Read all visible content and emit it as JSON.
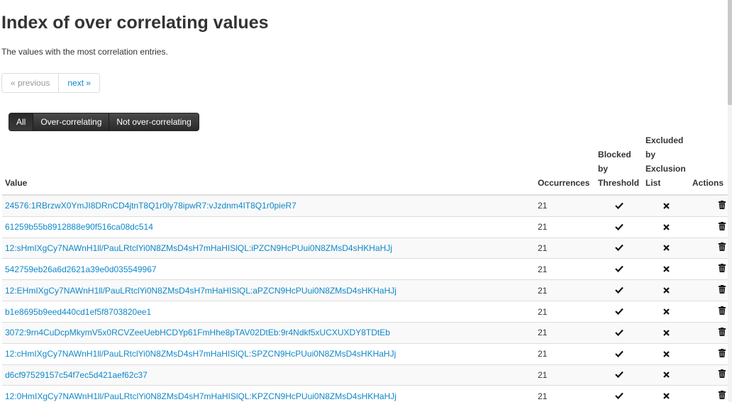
{
  "page": {
    "title": "Index of over correlating values",
    "subtitle": "The values with the most correlation entries."
  },
  "pager": {
    "previous": "« previous",
    "next": "next »"
  },
  "filters": {
    "all": "All",
    "over": "Over-correlating",
    "not_over": "Not over-correlating",
    "selected": "All"
  },
  "table": {
    "headers": {
      "value": "Value",
      "occurrences": "Occurrences",
      "blocked_line1": "Blocked",
      "blocked_line2": "by",
      "blocked_line3": "Threshold",
      "excluded_line1": "Excluded",
      "excluded_line2": "by",
      "excluded_line3": "Exclusion",
      "excluded_line4": "List",
      "actions": "Actions"
    },
    "rows": [
      {
        "value": "24576:1RBrzwX0YmJI8DRnCD4jtnT8Q1r0ly78ipwR7:vJzdnm4IT8Q1r0pieR7",
        "occurrences": "21",
        "blocked": true,
        "excluded": false
      },
      {
        "value": "61259b55b8912888e90f516ca08dc514",
        "occurrences": "21",
        "blocked": true,
        "excluded": false
      },
      {
        "value": "12:sHmIXgCy7NAWnH1ll/PauLRtclYi0N8ZMsD4sH7mHaHISlQL:iPZCN9HcPUui0N8ZMsD4sHKHaHJj",
        "occurrences": "21",
        "blocked": true,
        "excluded": false
      },
      {
        "value": "542759eb26a6d2621a39e0d035549967",
        "occurrences": "21",
        "blocked": true,
        "excluded": false
      },
      {
        "value": "12:EHmIXgCy7NAWnH1ll/PauLRtclYi0N8ZMsD4sH7mHaHISlQL:aPZCN9HcPUui0N8ZMsD4sHKHaHJj",
        "occurrences": "21",
        "blocked": true,
        "excluded": false
      },
      {
        "value": "b1e8695b9eed440cd1ef5f8703820ee1",
        "occurrences": "21",
        "blocked": true,
        "excluded": false
      },
      {
        "value": "3072:9rn4CuDcpMkymV5x0RCVZeeUebHCDYp61FmHhe8pTAV02DtEb:9r4Ndkf5xUCXUXDY8TDtEb",
        "occurrences": "21",
        "blocked": true,
        "excluded": false
      },
      {
        "value": "12:cHmIXgCy7NAWnH1ll/PauLRtclYi0N8ZMsD4sH7mHaHISlQL:SPZCN9HcPUui0N8ZMsD4sHKHaHJj",
        "occurrences": "21",
        "blocked": true,
        "excluded": false
      },
      {
        "value": "d6cf97529157c54f7ec5d421aef62c37",
        "occurrences": "21",
        "blocked": true,
        "excluded": false
      },
      {
        "value": "12:0HmIXgCy7NAWnH1ll/PauLRtclYi0N8ZMsD4sH7mHaHISlQL:KPZCN9HcPUui0N8ZMsD4sHKHaHJj",
        "occurrences": "21",
        "blocked": true,
        "excluded": false
      }
    ]
  },
  "icons": {
    "blocked_true": "check-icon",
    "excluded_false": "times-icon",
    "action": "trash-icon"
  },
  "colors": {
    "link": "#0e88c9",
    "filter_bg": "#333333",
    "row_stripe": "#f9f9f9"
  }
}
